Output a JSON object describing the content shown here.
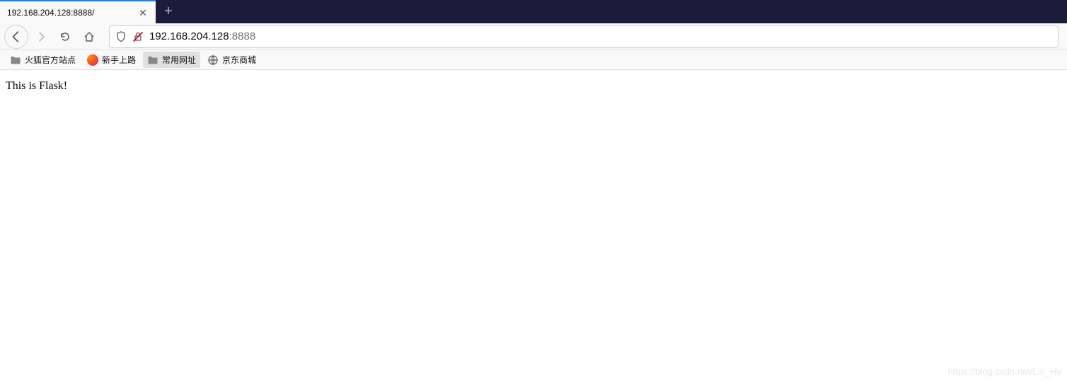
{
  "tabStrip": {
    "activeTab": {
      "title": "192.168.204.128:8888/"
    }
  },
  "navToolbar": {
    "url": {
      "host": "192.168.204.128",
      "portSuffix": ":8888"
    }
  },
  "bookmarksBar": {
    "items": [
      {
        "label": "火狐官方站点",
        "icon": "folder"
      },
      {
        "label": "新手上路",
        "icon": "firefox"
      },
      {
        "label": "常用网址",
        "icon": "folder",
        "active": true
      },
      {
        "label": "京东商城",
        "icon": "globe"
      }
    ]
  },
  "page": {
    "body": "This is Flask!"
  },
  "watermark": "https://blog.csdn.net/Lin_Hv"
}
